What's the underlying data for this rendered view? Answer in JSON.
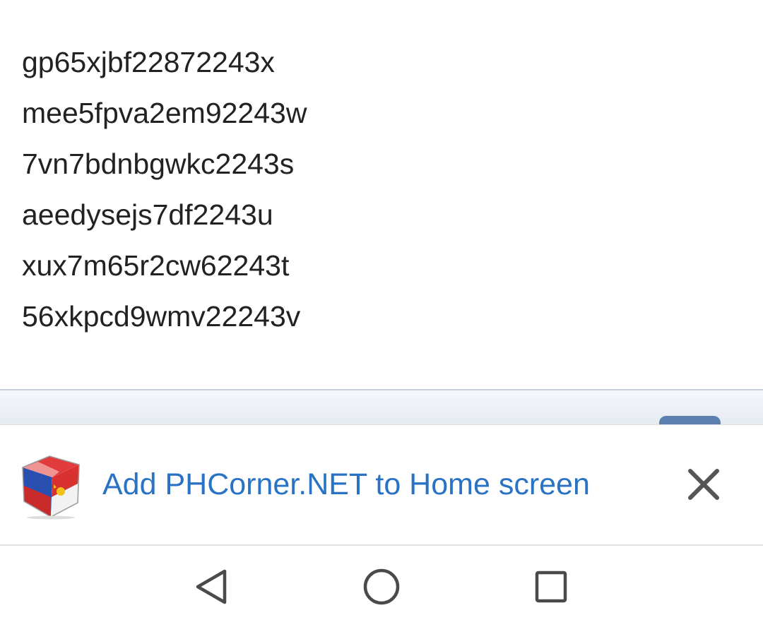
{
  "codes": [
    "gp65xjbf22872243x",
    "mee5fpva2em92243w",
    "7vn7bdnbgwkc2243s",
    "aeedysejs7df2243u",
    "xux7m65r2cw62243t",
    "56xkpcd9wmv22243v"
  ],
  "banner": {
    "text": "Add PHCorner.NET to Home screen",
    "icon": "phcorner-logo-icon",
    "close_icon": "close-icon",
    "text_color": "#2a73c4"
  },
  "navbar": {
    "back_icon": "back-triangle-icon",
    "home_icon": "home-circle-icon",
    "recents_icon": "recents-square-icon"
  }
}
